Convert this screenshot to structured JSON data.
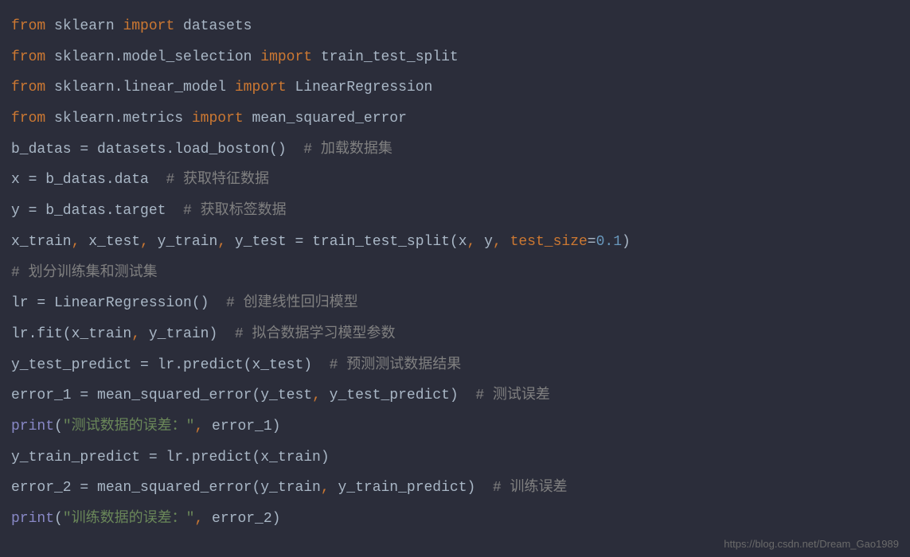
{
  "lines": {
    "l1": {
      "from": "from",
      "mod": " sklearn ",
      "import": "import",
      "item": " datasets"
    },
    "l2": {
      "from": "from",
      "mod": " sklearn.model_selection ",
      "import": "import",
      "item": " train_test_split"
    },
    "l3": {
      "from": "from",
      "mod": " sklearn.linear_model ",
      "import": "import",
      "item": " LinearRegression"
    },
    "l4": {
      "from": "from",
      "mod": " sklearn.metrics ",
      "import": "import",
      "item": " mean_squared_error"
    },
    "l5": {
      "code": "b_datas = datasets.load_boston()  ",
      "comment": "# 加载数据集"
    },
    "l6": {
      "code": "x = b_datas.data  ",
      "comment": "# 获取特征数据"
    },
    "l7": {
      "code": "y = b_datas.target  ",
      "comment": "# 获取标签数据"
    },
    "l8": {
      "p1": "x_train",
      "c1": ", ",
      "p2": "x_test",
      "c2": ", ",
      "p3": "y_train",
      "c3": ", ",
      "p4": "y_test = train_test_split(x",
      "c4": ", ",
      "p5": "y",
      "c5": ", ",
      "param": "test_size",
      "eq": "=",
      "num": "0.1",
      "close": ")"
    },
    "l9": {
      "comment": "# 划分训练集和测试集"
    },
    "l10": {
      "code": "lr = LinearRegression()  ",
      "comment": "# 创建线性回归模型"
    },
    "l11": {
      "p1": "lr.fit(x_train",
      "c1": ", ",
      "p2": "y_train)  ",
      "comment": "# 拟合数据学习模型参数"
    },
    "l12": {
      "code": "y_test_predict = lr.predict(x_test)  ",
      "comment": "# 预测测试数据结果"
    },
    "l13": {
      "p1": "error_1 = mean_squared_error(y_test",
      "c1": ", ",
      "p2": "y_test_predict)  ",
      "comment": "# 测试误差"
    },
    "l14": {
      "fn": "print",
      "open": "(",
      "str": "\"测试数据的误差：\"",
      "c1": ", ",
      "arg": "error_1)"
    },
    "l15": {
      "code": "y_train_predict = lr.predict(x_train)"
    },
    "l16": {
      "p1": "error_2 = mean_squared_error(y_train",
      "c1": ", ",
      "p2": "y_train_predict)  ",
      "comment": "# 训练误差"
    },
    "l17": {
      "fn": "print",
      "open": "(",
      "str": "\"训练数据的误差：\"",
      "c1": ", ",
      "arg": "error_2)"
    }
  },
  "watermark": "https://blog.csdn.net/Dream_Gao1989"
}
